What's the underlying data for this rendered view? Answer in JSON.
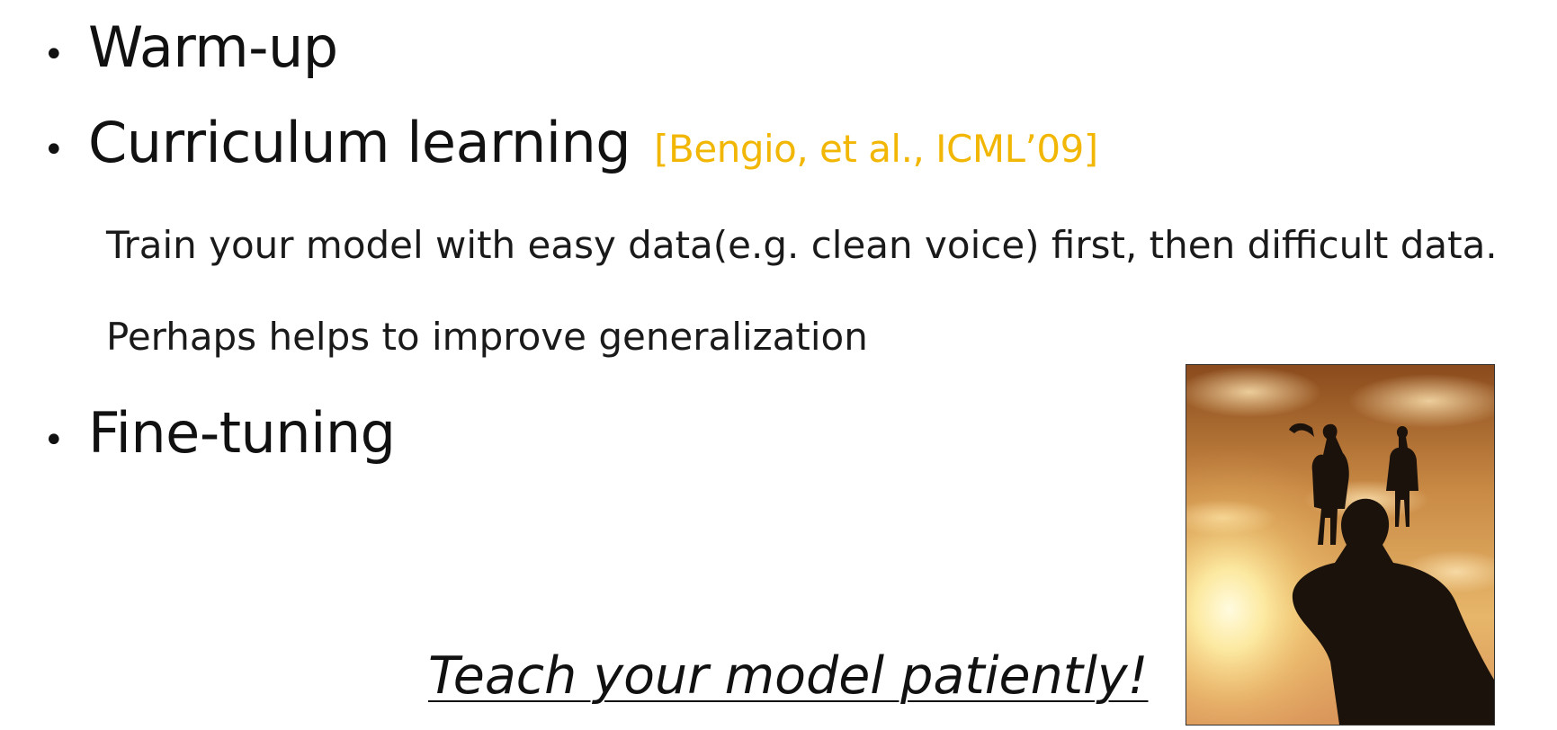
{
  "bullets": [
    {
      "text": "Warm-up"
    },
    {
      "text": "Curriculum learning",
      "citation": "[Bengio, et al., ICML’09]"
    },
    {
      "text": "Fine-tuning"
    }
  ],
  "curriculum_details": [
    "Train your model with easy data(e.g. clean voice) first, then difficult data.",
    "Perhaps helps to improve generalization"
  ],
  "tagline": "Teach your model patiently!",
  "colors": {
    "citation": "#f2b705",
    "text": "#111111",
    "sky_top": "#8a4a1c",
    "sky_glow": "#fff3b0"
  }
}
